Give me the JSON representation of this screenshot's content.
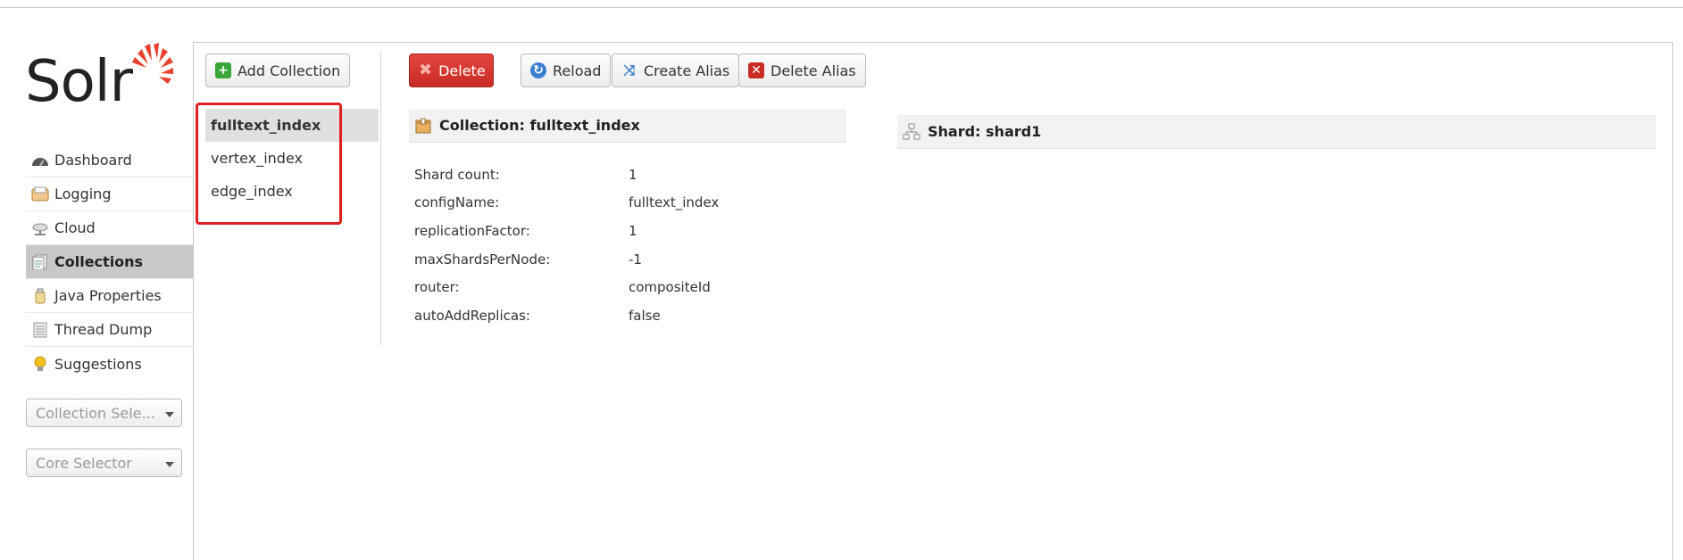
{
  "app": {
    "logo_text": "Solr"
  },
  "nav": {
    "items": [
      {
        "label": "Dashboard",
        "icon": "dashboard-icon"
      },
      {
        "label": "Logging",
        "icon": "logging-icon"
      },
      {
        "label": "Cloud",
        "icon": "cloud-icon"
      },
      {
        "label": "Collections",
        "icon": "collections-icon",
        "active": true
      },
      {
        "label": "Java Properties",
        "icon": "java-properties-icon"
      },
      {
        "label": "Thread Dump",
        "icon": "thread-dump-icon"
      },
      {
        "label": "Suggestions",
        "icon": "lightbulb-icon"
      }
    ],
    "collection_selector": "Collection Sele...",
    "core_selector": "Core Selector"
  },
  "toolbar": {
    "add_collection": "Add Collection",
    "delete": "Delete",
    "reload": "Reload",
    "create_alias": "Create Alias",
    "delete_alias": "Delete Alias"
  },
  "collections": {
    "items": [
      "fulltext_index",
      "vertex_index",
      "edge_index"
    ],
    "selected": "fulltext_index"
  },
  "collection_panel": {
    "title": "Collection: fulltext_index",
    "properties": [
      {
        "key": "Shard count:",
        "value": "1"
      },
      {
        "key": "configName:",
        "value": "fulltext_index"
      },
      {
        "key": "replicationFactor:",
        "value": "1"
      },
      {
        "key": "maxShardsPerNode:",
        "value": "-1"
      },
      {
        "key": "router:",
        "value": "compositeId"
      },
      {
        "key": "autoAddReplicas:",
        "value": "false"
      }
    ]
  },
  "shard_panel": {
    "title": "Shard: shard1"
  },
  "colors": {
    "active_nav_bg": "#c8c8c8",
    "danger_button": "#d73a32",
    "highlight_box": "#e02020",
    "logo_sun": "#e8412f"
  }
}
